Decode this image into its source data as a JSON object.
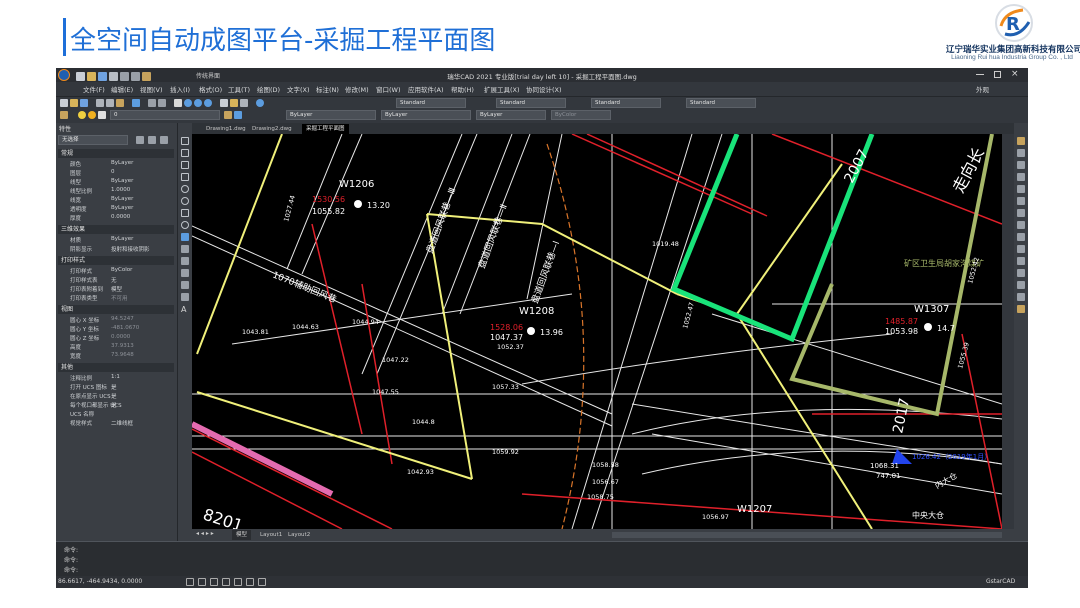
{
  "slide": {
    "title": "全空间自动成图平台-采掘工程平面图",
    "logo_cn": "辽宁瑞华实业集团高新科技有限公司",
    "logo_en": "Liaoning Rui hua Industria Group Co. , Ltd"
  },
  "app": {
    "window_title": "瑞华CAD 2021 专业版[trial day left 10] - 采掘工程平面图.dwg",
    "quick_label": "传统界面",
    "menus": [
      "文件(F)",
      "编辑(E)",
      "视图(V)",
      "插入(I)",
      "格式(O)",
      "工具(T)",
      "绘图(D)",
      "文字(X)",
      "标注(N)",
      "修改(M)",
      "窗口(W)",
      "应用软件(A)",
      "帮助(H)",
      "扩展工具(X)",
      "协同设计(X)"
    ],
    "right_label": "外观",
    "style_dropdowns": [
      "Standard",
      "Standard",
      "Standard",
      "Standard"
    ],
    "layer_dropdown": "0",
    "color_dropdown": "ByLayer",
    "linetype_dropdown": "ByLayer",
    "lineweight_dropdown": "ByLayer",
    "plotstyle_dropdown": "ByColor"
  },
  "properties": {
    "header": "特性",
    "selection": "无选择",
    "sections": [
      {
        "title": "常规",
        "rows": [
          [
            "颜色",
            "ByLayer"
          ],
          [
            "图层",
            "0"
          ],
          [
            "线型",
            "ByLayer"
          ],
          [
            "线型比例",
            "1.0000"
          ],
          [
            "线宽",
            "ByLayer"
          ],
          [
            "透明度",
            "ByLayer"
          ],
          [
            "厚度",
            "0.0000"
          ]
        ]
      },
      {
        "title": "三维效果",
        "rows": [
          [
            "材质",
            "ByLayer"
          ],
          [
            "阴影显示",
            "投射和接收阴影"
          ]
        ]
      },
      {
        "title": "打印样式",
        "rows": [
          [
            "打印样式",
            "ByColor"
          ],
          [
            "打印样式表",
            "无"
          ],
          [
            "打印表附着到",
            "模型"
          ],
          [
            "打印表类型",
            "不可用"
          ]
        ]
      },
      {
        "title": "视图",
        "rows": [
          [
            "圆心 X 坐标",
            "94.5247"
          ],
          [
            "圆心 Y 坐标",
            "-481.0670"
          ],
          [
            "圆心 Z 坐标",
            "0.0000"
          ],
          [
            "高度",
            "37.9313"
          ],
          [
            "宽度",
            "73.9648"
          ]
        ]
      },
      {
        "title": "其他",
        "rows": [
          [
            "注释比例",
            "1:1"
          ],
          [
            "打开 UCS 图标",
            "是"
          ],
          [
            "在原点显示 UCS",
            "是"
          ],
          [
            "每个视口都显示 UCS",
            "是"
          ],
          [
            "UCS 名称",
            ""
          ],
          [
            "视觉样式",
            "二维线框"
          ]
        ]
      }
    ]
  },
  "tabs": [
    "Drawing1.dwg",
    "Drawing2.dwg",
    "采掘工程平面图"
  ],
  "layout_tabs": [
    "模型",
    "Layout1",
    "Layout2"
  ],
  "command_lines": [
    "命令:",
    "命令:",
    "命令:"
  ],
  "status_coords": "86.6617, -464.9434, 0.0000",
  "status_right": "GstarCAD",
  "drawing": {
    "points": [
      {
        "name": "W1206",
        "elev_red": "1530.56",
        "elev": "1055.82",
        "val": "13.20"
      },
      {
        "name": "W1208",
        "elev_red": "1528.06",
        "elev": "1047.37",
        "val": "13.96"
      },
      {
        "name": "W1307",
        "elev_red": "1485.87",
        "elev": "1053.98",
        "val": "14.7"
      },
      {
        "name": "W1207",
        "elev": "1068.31",
        "val": "747.01"
      }
    ],
    "labels": [
      "1070辅助回风巷",
      "盘道回风联巷—Ⅲ",
      "盘道回风联巷—Ⅱ",
      "盘道回风联巷—Ⅰ",
      "矿区卫生局胡家沟煤矿",
      "2017",
      "2007",
      "中央大仓",
      "内大仓",
      "1026.42（2019年1月）",
      "8201",
      "走向长"
    ],
    "numbers": [
      "1027.44",
      "1043.81",
      "1044.63",
      "1044.94",
      "1047.22",
      "1047.55",
      "1052.47",
      "1057.33",
      "1059.92",
      "1058.58",
      "1056.67",
      "1056.97",
      "1055.39",
      "1052.42",
      "1019.48",
      "1052.37",
      "1058.75",
      "1044.8",
      "1042.93"
    ]
  },
  "colors": {
    "accent": "#1f6fd6",
    "canvas": "#000000",
    "panel": "#3a3e44",
    "yellow_line": "#f0f07a",
    "green_line": "#19e37a",
    "olive_line": "#a7b86a",
    "red_line": "#e0202a",
    "pink_line": "#e46bb0"
  }
}
